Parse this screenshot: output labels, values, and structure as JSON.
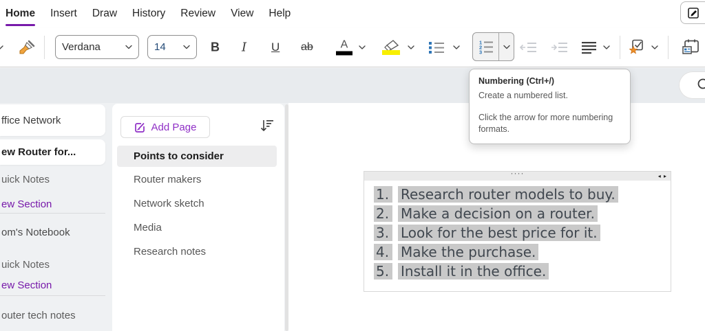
{
  "colors": {
    "accent_purple": "#7719aa",
    "add_page_purple": "#8f2fc6",
    "selection_highlight": "#c9c9c9",
    "band_background": "#e8ebee",
    "icon_blue": "#2e75b6",
    "star_orange": "#ec8f2a",
    "highlighter_yellow": "#f8ef00",
    "font_size_blue": "#234a77"
  },
  "menu": {
    "items": [
      {
        "label": "Home",
        "active": true
      },
      {
        "label": "Insert"
      },
      {
        "label": "Draw"
      },
      {
        "label": "History"
      },
      {
        "label": "Review"
      },
      {
        "label": "View"
      },
      {
        "label": "Help"
      }
    ]
  },
  "toolbar": {
    "font_name": "Verdana",
    "font_size": "14",
    "bold": "B",
    "italic": "I",
    "underline": "U",
    "strikethrough": "ab",
    "font_color": "A"
  },
  "icons": {
    "format_painter": "orange-brush",
    "font_color": "A-with-black-bar",
    "highlighter": "marker-with-yellow-bar",
    "bullets": "blue-squares-list",
    "numbering": "123-numbered-list",
    "decrease_indent": "arrow-left-lines",
    "increase_indent": "arrow-right-lines",
    "align": "horizontal-lines",
    "todo_tag": "checkbox-with-orange-star",
    "meeting_details": "calendar-with-note",
    "sort": "arrow-down-with-lines",
    "add_page": "pencil-in-square",
    "search": "magnifier",
    "corner_edit": "pen-in-square"
  },
  "tooltip": {
    "title": "Numbering (Ctrl+/)",
    "body1": "Create a numbered list.",
    "body2": "Click the arrow for more numbering formats."
  },
  "sidebar": {
    "items": [
      {
        "label": "ffice Network"
      },
      {
        "label": "ew Router for..."
      },
      {
        "label": "uick Notes"
      },
      {
        "label": "ew Section"
      },
      {
        "label": "om's Notebook"
      },
      {
        "label": "uick Notes"
      },
      {
        "label": "ew Section"
      },
      {
        "label": "outer tech notes"
      }
    ]
  },
  "pages": {
    "add_button": "Add Page",
    "items": [
      {
        "title": "Points to consider",
        "selected": true
      },
      {
        "title": "Router makers"
      },
      {
        "title": "Network sketch"
      },
      {
        "title": "Media"
      },
      {
        "title": "Research notes"
      }
    ]
  },
  "note": {
    "handle": "····",
    "resize": "◂ ▸",
    "list": [
      {
        "num": "1.",
        "text": "Research router models to buy."
      },
      {
        "num": "2.",
        "text": "Make a decision on a router."
      },
      {
        "num": "3.",
        "text": "Look for the best price for it."
      },
      {
        "num": "4.",
        "text": "Make the purchase."
      },
      {
        "num": "5.",
        "text": "Install it in the office."
      }
    ]
  }
}
